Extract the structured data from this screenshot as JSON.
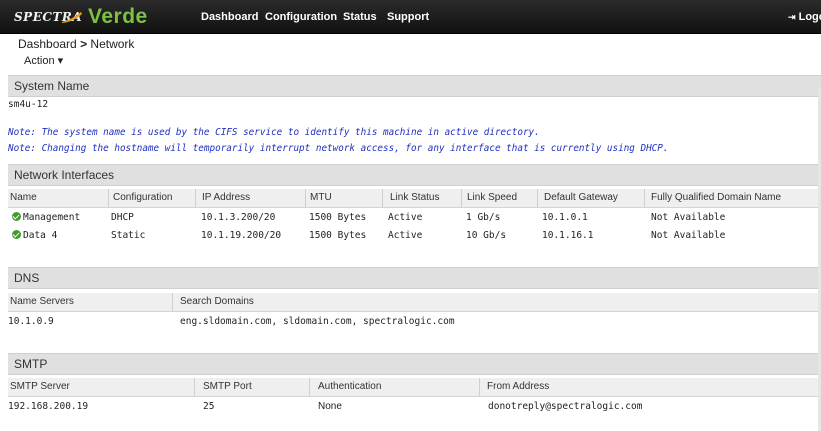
{
  "header": {
    "logo_spectra": "SPECTRA",
    "logo_verde": "Verde",
    "nav": [
      "Dashboard",
      "Configuration",
      "Status",
      "Support"
    ],
    "logout": "Logout"
  },
  "breadcrumb": {
    "root": "Dashboard",
    "separator": ">",
    "current": "Network"
  },
  "action_label": "Action ▾",
  "system_name": {
    "title": "System Name",
    "value": "sm4u-12",
    "note1": "Note: The system name is used by the CIFS service to identify this machine in active directory.",
    "note2": "Note: Changing the hostname will temporarily interrupt network access, for any interface that is currently using DHCP."
  },
  "network_interfaces": {
    "title": "Network Interfaces",
    "headers": [
      "Name",
      "Configuration",
      "IP Address",
      "MTU",
      "Link Status",
      "Link Speed",
      "Default Gateway",
      "Fully Qualified Domain Name"
    ],
    "rows": [
      [
        "Management",
        "DHCP",
        "10.1.3.200/20",
        "1500 Bytes",
        "Active",
        "1 Gb/s",
        "10.1.0.1",
        "Not Available"
      ],
      [
        "Data 4",
        "Static",
        "10.1.19.200/20",
        "1500 Bytes",
        "Active",
        "10 Gb/s",
        "10.1.16.1",
        "Not Available"
      ]
    ]
  },
  "dns": {
    "title": "DNS",
    "headers": [
      "Name Servers",
      "Search Domains"
    ],
    "row": [
      "10.1.0.9",
      "eng.sldomain.com, sldomain.com, spectralogic.com"
    ]
  },
  "smtp": {
    "title": "SMTP",
    "headers": [
      "SMTP Server",
      "SMTP Port",
      "Authentication",
      "From Address"
    ],
    "row": [
      "192.168.200.19",
      "25",
      "None",
      "donotreply@spectralogic.com"
    ]
  }
}
